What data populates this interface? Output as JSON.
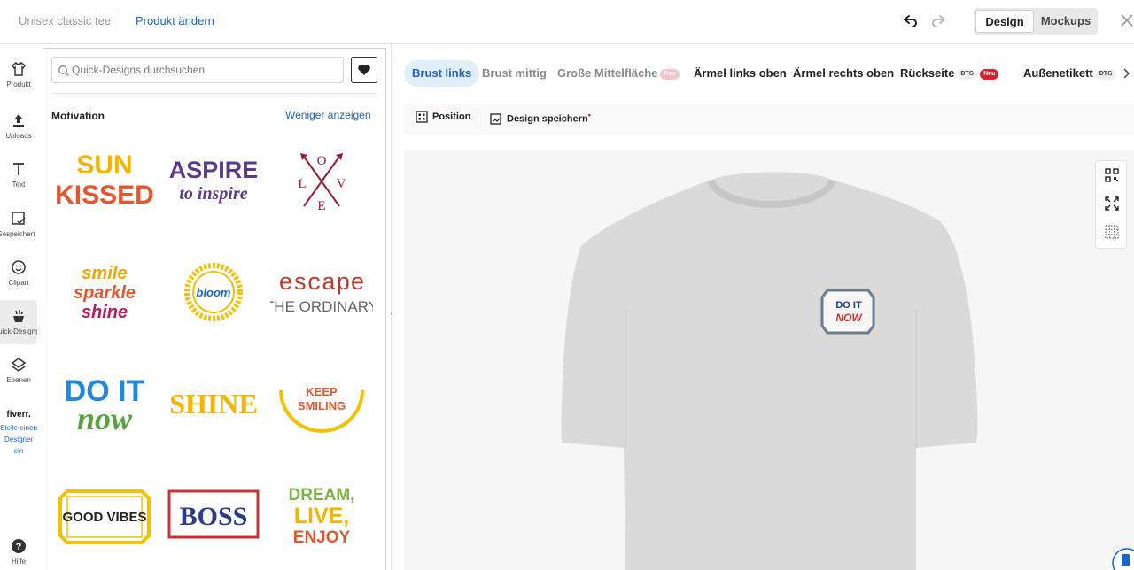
{
  "header": {
    "product_name": "Unisex classic tee",
    "change_product": "Produkt ändern",
    "view_options": [
      "Design",
      "Mockups"
    ],
    "active_view": "Design"
  },
  "sidebar": {
    "items": [
      {
        "label": "Produkt",
        "icon": "shirt-icon"
      },
      {
        "label": "Uploads",
        "icon": "upload-icon"
      },
      {
        "label": "Text",
        "icon": "text-icon"
      },
      {
        "label": "Gespeichert",
        "icon": "saved-icon"
      },
      {
        "label": "Clipart",
        "icon": "smiley-icon"
      },
      {
        "label": "Quick-Designs",
        "icon": "quick-designs-icon"
      },
      {
        "label": "Ebenen",
        "icon": "layers-icon"
      }
    ],
    "active": "Quick-Designs",
    "fiverr": {
      "logo": "fiverr.",
      "text": "Stelle einen Designer ein"
    },
    "help": "Hilfe"
  },
  "panel": {
    "search_placeholder": "Quick-Designs durchsuchen",
    "category": "Motivation",
    "toggle_link": "Weniger anzeigen",
    "designs": [
      {
        "id": "sun",
        "lines": [
          "SUN",
          "KISSED"
        ]
      },
      {
        "id": "aspire",
        "lines": [
          "ASPIRE",
          "to inspire"
        ]
      },
      {
        "id": "love",
        "lines": [
          "O",
          "L",
          "V",
          "E"
        ]
      },
      {
        "id": "smile",
        "lines": [
          "smile",
          "sparkle",
          "shine"
        ]
      },
      {
        "id": "bloom",
        "lines": [
          "bloom"
        ]
      },
      {
        "id": "escape",
        "lines": [
          "escape",
          "THE ORDINARY"
        ]
      },
      {
        "id": "doit",
        "lines": [
          "DO IT",
          "now"
        ]
      },
      {
        "id": "shine",
        "lines": [
          "SHINE"
        ]
      },
      {
        "id": "keep",
        "lines": [
          "KEEP",
          "SMILING"
        ]
      },
      {
        "id": "goodvibes",
        "lines": [
          "GOOD VIBES"
        ]
      },
      {
        "id": "boss",
        "lines": [
          "BOSS"
        ]
      },
      {
        "id": "dream",
        "lines": [
          "DREAM,",
          "LIVE,",
          "ENJOY"
        ]
      }
    ]
  },
  "placements": {
    "tabs": [
      {
        "label": "Brust links",
        "active": true
      },
      {
        "label": "Brust mittig",
        "muted": true
      },
      {
        "label": "Große Mittelfläche",
        "muted": true,
        "badge": "Neu",
        "badge_style": "neu-light"
      },
      {
        "label": "Ärmel links oben"
      },
      {
        "label": "Ärmel rechts oben"
      },
      {
        "label": "Rückseite",
        "tag": "DTG",
        "badge": "Neu",
        "badge_style": "neu"
      },
      {
        "label": "Außenetikett",
        "tag": "DTG"
      }
    ]
  },
  "toolbar": {
    "position": "Position",
    "save_design": "Design speichern"
  },
  "canvas": {
    "print_text": [
      "DO IT",
      "NOW"
    ]
  },
  "colors": {
    "accent": "#1c64c8",
    "badge_red": "#d81f2e",
    "shirt": "#dadada"
  }
}
